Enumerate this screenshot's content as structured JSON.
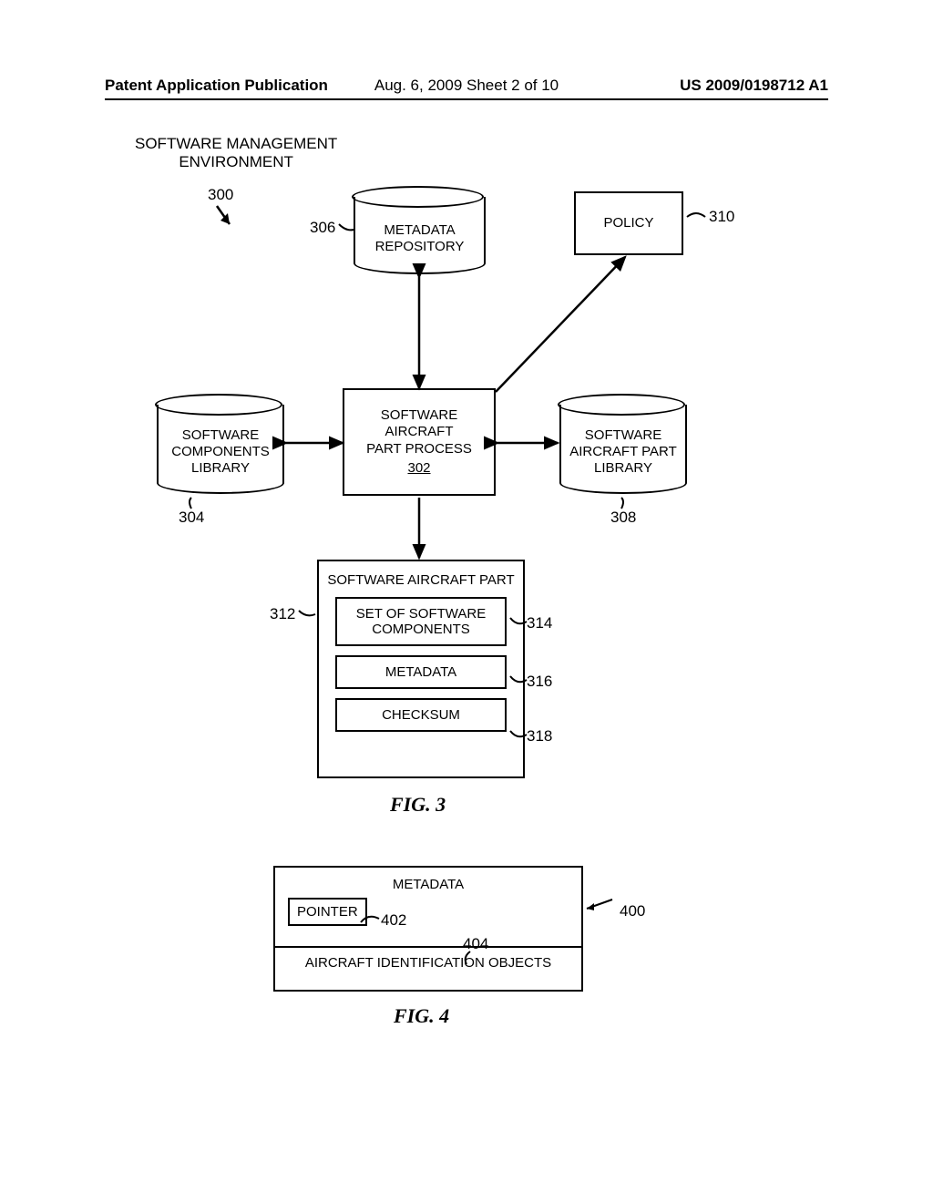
{
  "header": {
    "left": "Patent Application Publication",
    "center": "Aug. 6, 2009  Sheet 2 of 10",
    "right": "US 2009/0198712 A1"
  },
  "fig3": {
    "env_label_line1": "SOFTWARE MANAGEMENT",
    "env_label_line2": "ENVIRONMENT",
    "env_ref": "300",
    "metadata_repo": "METADATA\nREPOSITORY",
    "metadata_repo_ref": "306",
    "policy": "POLICY",
    "policy_ref": "310",
    "sw_components_lib": "SOFTWARE\nCOMPONENTS\nLIBRARY",
    "sw_components_lib_ref": "304",
    "sw_aircraft_process": "SOFTWARE\nAIRCRAFT\nPART PROCESS",
    "sw_aircraft_process_ref": "302",
    "sw_aircraft_lib": "SOFTWARE\nAIRCRAFT PART\nLIBRARY",
    "sw_aircraft_lib_ref": "308",
    "sap_title": "SOFTWARE AIRCRAFT PART",
    "sap_ref": "312",
    "sap_components": "SET OF SOFTWARE\nCOMPONENTS",
    "sap_components_ref": "314",
    "sap_metadata": "METADATA",
    "sap_metadata_ref": "316",
    "sap_checksum": "CHECKSUM",
    "sap_checksum_ref": "318",
    "caption": "FIG. 3"
  },
  "fig4": {
    "title": "METADATA",
    "ref": "400",
    "pointer": "POINTER",
    "pointer_ref": "402",
    "aio": "AIRCRAFT IDENTIFICATION OBJECTS",
    "aio_ref": "404",
    "caption": "FIG. 4"
  }
}
